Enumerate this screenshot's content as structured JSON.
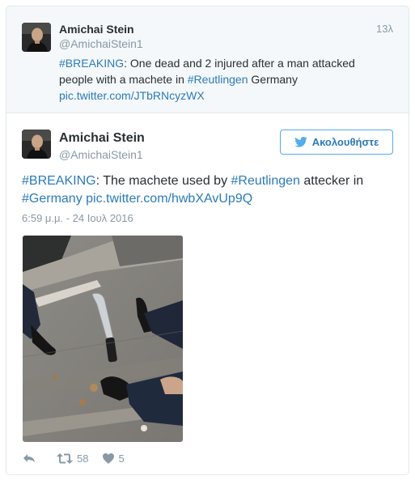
{
  "parent_tweet": {
    "author_name": "Amichai Stein",
    "author_handle": "@AmichaiStein1",
    "time": "13λ",
    "text_parts": [
      "#BREAKING",
      ": One dead and 2 injured after a man attacked people with a machete in ",
      "#Reutlingen",
      " Germany",
      "pic.twitter.com/JTbRNcyzWX"
    ]
  },
  "main_tweet": {
    "author_name": "Amichai Stein",
    "author_handle": "@AmichaiStein1",
    "follow_label": "Ακολουθήστε",
    "text_parts": [
      "#BREAKING",
      ": The machete used by ",
      "#Reutlingen",
      " attecker in ",
      "#Germany",
      " ",
      "pic.twitter.com/hwbXAvUp9Q"
    ],
    "timestamp": "6:59 μ.μ. - 24 Ιουλ 2016",
    "retweet_count": "58",
    "like_count": "5"
  },
  "icons": {
    "follow": "twitter-bird-icon",
    "reply": "reply-icon",
    "retweet": "retweet-icon",
    "like": "heart-icon"
  },
  "colors": {
    "link": "#2b7bb9",
    "muted": "#8899a6",
    "text": "#292f33",
    "follow_border": "#55acee",
    "parent_bg": "#f5f8fa"
  }
}
